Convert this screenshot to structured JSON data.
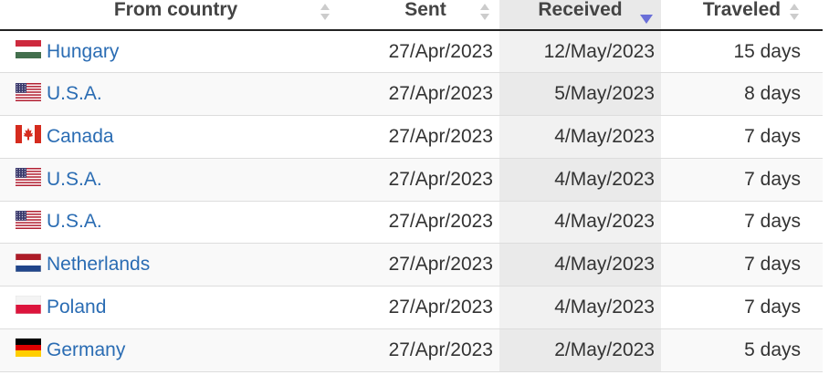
{
  "table": {
    "headers": {
      "country": "From country",
      "sent": "Sent",
      "received": "Received",
      "traveled": "Traveled"
    },
    "sorted_column": "received",
    "sort_direction": "descending",
    "rows": [
      {
        "flag": "hungary-flag-icon",
        "country": "Hungary",
        "sent": "27/Apr/2023",
        "received": "12/May/2023",
        "traveled": "15 days"
      },
      {
        "flag": "usa-flag-icon",
        "country": "U.S.A.",
        "sent": "27/Apr/2023",
        "received": "5/May/2023",
        "traveled": "8 days"
      },
      {
        "flag": "canada-flag-icon",
        "country": "Canada",
        "sent": "27/Apr/2023",
        "received": "4/May/2023",
        "traveled": "7 days"
      },
      {
        "flag": "usa-flag-icon",
        "country": "U.S.A.",
        "sent": "27/Apr/2023",
        "received": "4/May/2023",
        "traveled": "7 days"
      },
      {
        "flag": "usa-flag-icon",
        "country": "U.S.A.",
        "sent": "27/Apr/2023",
        "received": "4/May/2023",
        "traveled": "7 days"
      },
      {
        "flag": "netherlands-flag-icon",
        "country": "Netherlands",
        "sent": "27/Apr/2023",
        "received": "4/May/2023",
        "traveled": "7 days"
      },
      {
        "flag": "poland-flag-icon",
        "country": "Poland",
        "sent": "27/Apr/2023",
        "received": "4/May/2023",
        "traveled": "7 days"
      },
      {
        "flag": "germany-flag-icon",
        "country": "Germany",
        "sent": "27/Apr/2023",
        "received": "2/May/2023",
        "traveled": "5 days"
      }
    ]
  },
  "colors": {
    "link": "#2a6cb3",
    "sorted_column_bg": "#eaeaea",
    "sort_active_arrow": "#6a6fd8",
    "sort_inactive_arrow": "#cccccc"
  }
}
